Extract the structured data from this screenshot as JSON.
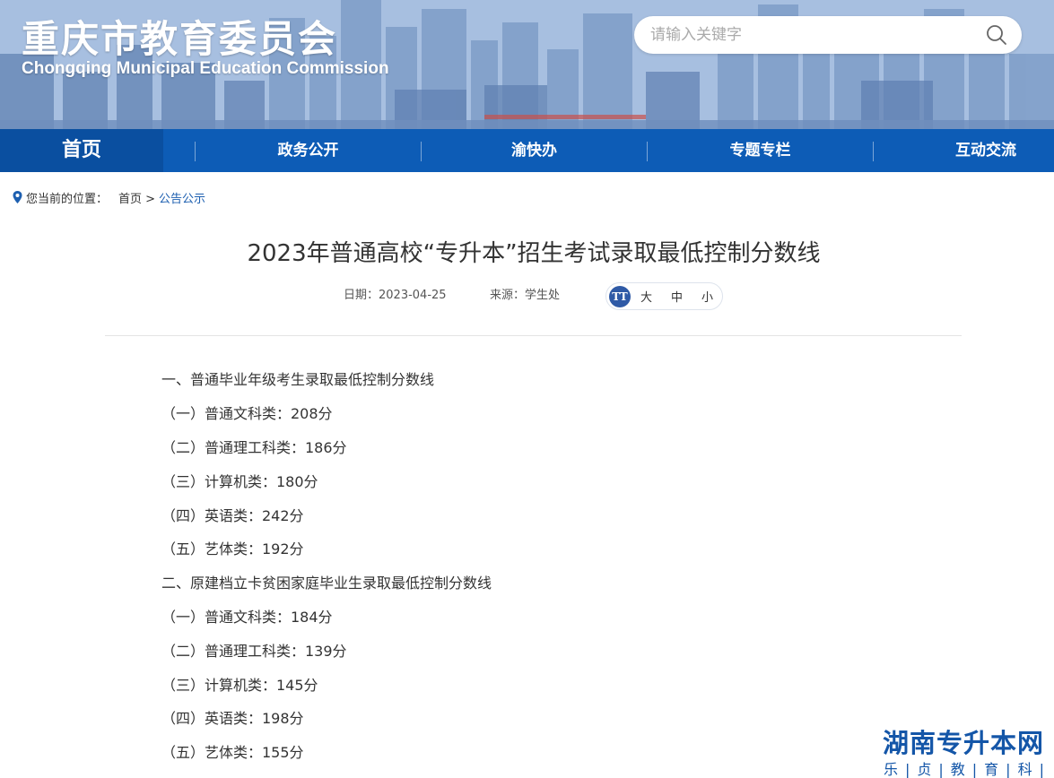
{
  "header": {
    "title": "重庆市教育委员会",
    "subtitle": "Chongqing Municipal Education Commission",
    "search_placeholder": "请输入关键字"
  },
  "nav": {
    "items": [
      "首页",
      "政务公开",
      "渝快办",
      "专题专栏",
      "互动交流"
    ]
  },
  "breadcrumb": {
    "prefix": "您当前的位置：",
    "home": "首页 >",
    "current": "公告公示"
  },
  "article": {
    "title": "2023年普通高校“专升本”招生考试录取最低控制分数线",
    "date": "日期：2023-04-25",
    "source": "来源：学生处",
    "font_sizes": [
      "大",
      "中",
      "小"
    ],
    "lines": [
      "一、普通毕业年级考生录取最低控制分数线",
      "（一）普通文科类：208分",
      "（二）普通理工科类：186分",
      "（三）计算机类：180分",
      "（四）英语类：242分",
      "（五）艺体类：192分",
      "二、原建档立卡贫困家庭毕业生录取最低控制分数线",
      "（一）普通文科类：184分",
      "（二）普通理工科类：139分",
      "（三）计算机类：145分",
      "（四）英语类：198分",
      "（五）艺体类：155分"
    ]
  },
  "watermark": {
    "title": "湖南专升本网",
    "subtitle": "乐|贞|教|育|科|技"
  },
  "colors": {
    "nav_blue": "#0d5cb6",
    "link_blue": "#1d5fb0",
    "watermark_blue": "#1456a8"
  }
}
